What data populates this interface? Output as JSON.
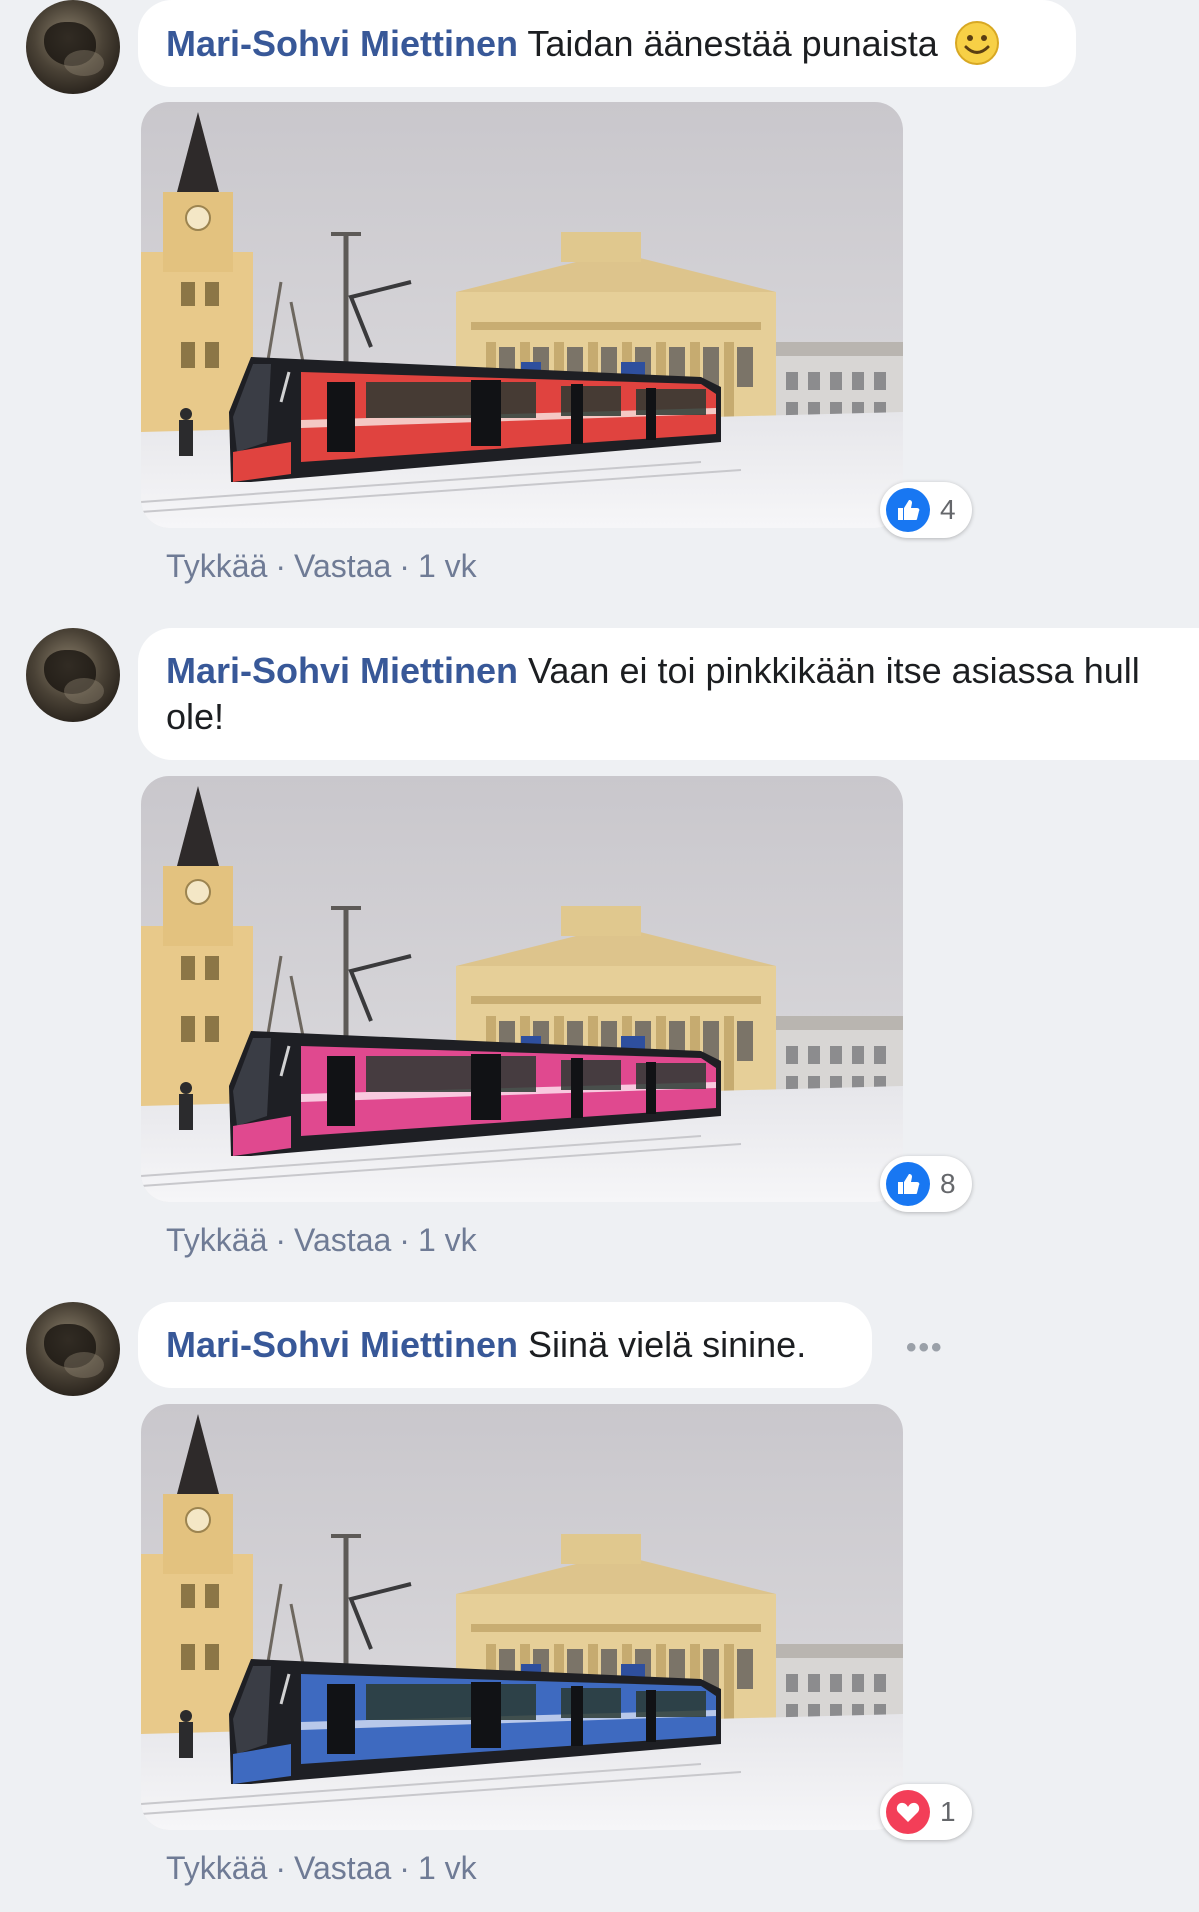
{
  "comments": [
    {
      "author": "Mari-Sohvi Miettinen",
      "text": "Taidan äänestää punaista",
      "emoji": "smiley-emoji",
      "tram_color": "#e0433f",
      "tram_stripe": "#f4c8c4",
      "reaction": {
        "icon": "like-icon",
        "count": "4",
        "color": "#1877f2"
      },
      "actions": {
        "like": "Tykkää",
        "reply": "Vastaa",
        "time": "1 vk"
      }
    },
    {
      "author": "Mari-Sohvi Miettinen",
      "text": "Vaan ei toi pinkkikään itse asiassa hull",
      "text_line2": "ole!",
      "tram_color": "#e0498f",
      "tram_stripe": "#f8c9df",
      "reaction": {
        "icon": "like-icon",
        "count": "8",
        "color": "#1877f2"
      },
      "actions": {
        "like": "Tykkää",
        "reply": "Vastaa",
        "time": "1 vk"
      }
    },
    {
      "author": "Mari-Sohvi Miettinen",
      "text": "Siinä vielä sinine.",
      "more": "•••",
      "tram_color": "#3e6ac0",
      "tram_stripe": "#b8c8ea",
      "reaction": {
        "icon": "love-icon",
        "count": "1",
        "color": "#f33e58"
      },
      "actions": {
        "like": "Tykkää",
        "reply": "Vastaa",
        "time": "1 vk"
      }
    }
  ]
}
